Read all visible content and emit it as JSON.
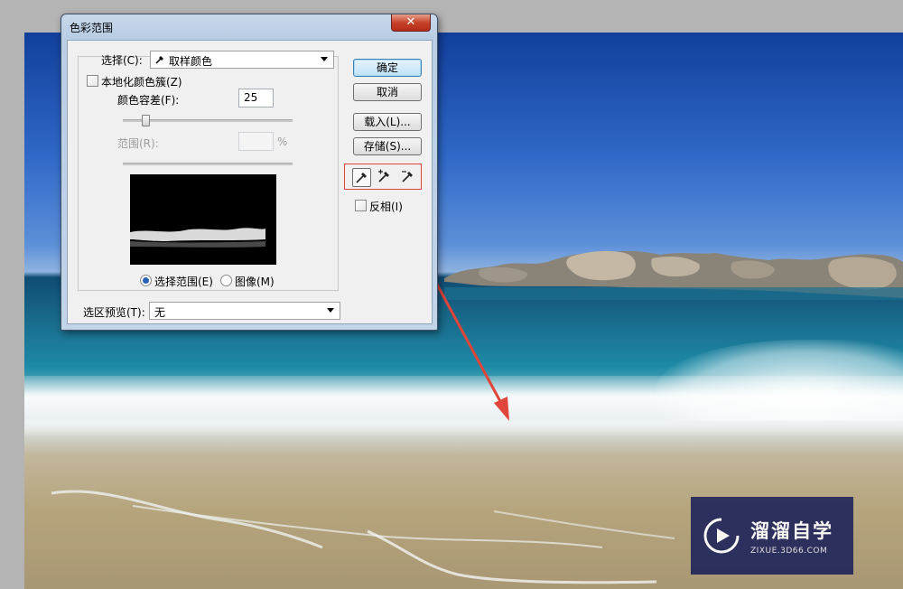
{
  "dialog": {
    "title": "色彩范围",
    "close_label": "✕",
    "select_label": "选择(C):",
    "select_value": "取样颜色",
    "localized_clusters_label": "本地化颜色簇(Z)",
    "fuzziness_label": "颜色容差(F):",
    "fuzziness_value": "25",
    "range_label": "范围(R):",
    "range_value": "",
    "range_unit": "%",
    "radio_selection_label": "选择范围(E)",
    "radio_image_label": "图像(M)",
    "radio_selected": "selection",
    "selection_preview_label": "选区预览(T):",
    "selection_preview_value": "无",
    "buttons": {
      "ok": "确定",
      "cancel": "取消",
      "load": "载入(L)...",
      "save": "存储(S)..."
    },
    "invert_label": "反相(I)",
    "tools": [
      "eyedropper-icon",
      "eyedropper-plus-icon",
      "eyedropper-minus-icon"
    ]
  },
  "watermark": {
    "brand": "溜溜自学",
    "url": "ZIXUE.3D66.COM"
  },
  "colors": {
    "annotation_red": "#e0453a",
    "default_button": "#bfe2f6",
    "watermark_bg": "#22275a"
  }
}
